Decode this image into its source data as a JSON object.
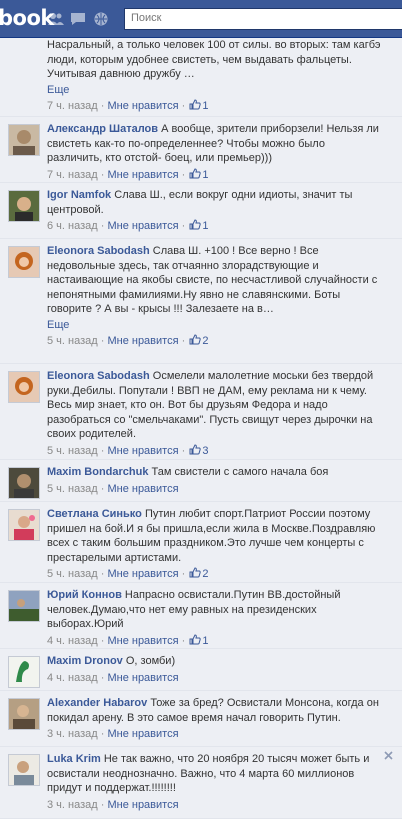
{
  "header": {
    "logo": "book",
    "search_placeholder": "Поиск",
    "icons": [
      "friend-requests-icon",
      "messages-icon",
      "notifications-icon"
    ],
    "brand_color": "#3b5998"
  },
  "comments": [
    {
      "author": "",
      "text": "Насральный, а только человек 100 от силы. во вторых: там кагбэ люди, которым удобнее свистеть, чем выдавать фальцеты. Учитывая давнюю дружбу …",
      "more": "Еще",
      "time": "7 ч. назад",
      "like": "Мне нравится",
      "likes": "1"
    },
    {
      "author": "Александр Шаталов",
      "text": "А вообще, зрители приборзели! Нельзя ли свистеть как-то по-определеннее? Чтобы можно было различить, кто отстой- боец, или премьер)))",
      "more": "Еще",
      "time": "7 ч. назад",
      "like": "Мне нравится",
      "likes": "1"
    },
    {
      "author": "Igor Namfok",
      "text": "Слава Ш., если вокруг одни идиоты, значит ты центровой.",
      "time": "6 ч. назад",
      "like": "Мне нравится",
      "likes": "1"
    },
    {
      "author": "Eleonora Sabodash",
      "text": "Слава Ш. +100 ! Все верно ! Все недовольные здесь, так отчаянно злорадствующие и настаивающие на якобы свисте, по несчастливой случайности с непонятными фамилиями.Ну явно не славянскими. Боты говорите ? А вы - крысы !!! Залезаете на в…",
      "more": "Еще",
      "time": "5 ч. назад",
      "like": "Мне нравится",
      "likes": "2"
    },
    {
      "author": "Eleonora Sabodash",
      "text": "Осмелели малолетние моськи без твердой руки.Дебилы. Попутали ! ВВП не ДАМ, ему реклама ни к чему. Весь мир знает, кто он. Вот бы друзьям Федора и надо разобраться со \"смельчаками\". Пусть свищут через дырочки на своих родителей.",
      "time": "5 ч. назад",
      "like": "Мне нравится",
      "likes": "3"
    },
    {
      "author": "Maxim Bondarchuk",
      "text": "Там свистели с самого начала боя",
      "time": "5 ч. назад",
      "like": "Мне нравится"
    },
    {
      "author": "Светлана Синько",
      "text": "Путин любит спорт.Патриот России поэтому пришел на бой.И я бы пришла,если жила в Москве.Поздравляю всех с таким большим праздником.Это лучше чем концерты с престарелыми артистами.",
      "time": "5 ч. назад",
      "like": "Мне нравится",
      "likes": "2"
    },
    {
      "author": "Юрий Коннов",
      "text": "Напрасно освистали.Путин ВВ.достойный человек.Думаю,что нет ему равных на президенских выборах.Юрий",
      "time": "4 ч. назад",
      "like": "Мне нравится",
      "likes": "1"
    },
    {
      "author": "Maxim Dronov",
      "text": "О, зомби)",
      "time": "4 ч. назад",
      "like": "Мне нравится"
    },
    {
      "author": "Alexander Habarov",
      "text": "Не так важно, что 20 ноября 20 тысяч может быть и освистали неоднозначно. Важно, что 4 марта 60 миллионов придут и поддержат.!!!!!!!!",
      "time": "3 ч. назад",
      "like": "Мне нравится"
    }
  ],
  "extra": {
    "habarov_text": "Тоже за бред? Освистали Монсона, когда он покидал арену. В это самое время начал говорить Путин.",
    "krim_author": "Luka Krim"
  }
}
